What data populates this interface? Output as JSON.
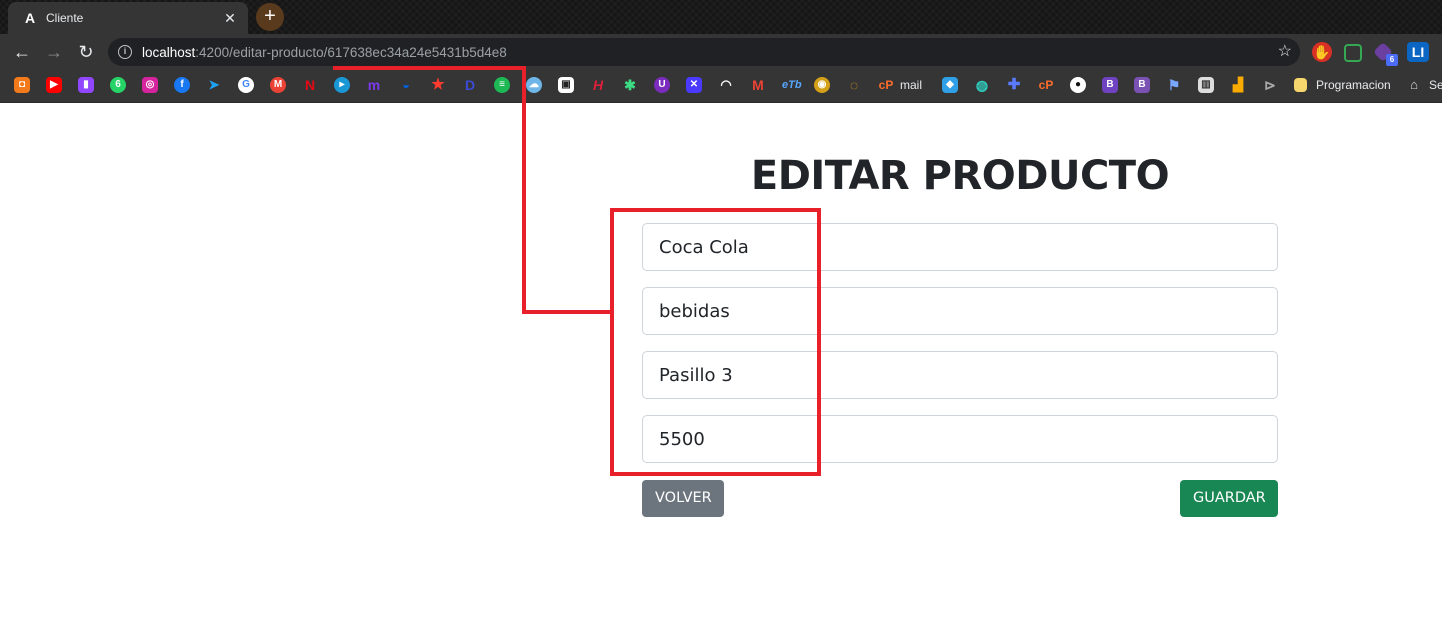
{
  "browser": {
    "tab": {
      "title": "Cliente",
      "favicon": "A",
      "close": "✕"
    },
    "new_tab": "+",
    "nav": {
      "back": "←",
      "forward": "→",
      "reload": "↻"
    },
    "address": {
      "info": "i",
      "host": "localhost",
      "path": ":4200/editar-producto/617638ec34a24e5431b5d4e8"
    },
    "bookmarks": {
      "mail_label": "mail",
      "programacion_label": "Programacion",
      "last_label": "Se"
    },
    "extensions": {
      "li_label": "LI",
      "badge": "6"
    }
  },
  "page": {
    "title": "EDITAR PRODUCTO",
    "fields": {
      "nombre": "Coca Cola",
      "categoria": "bebidas",
      "ubicacion": "Pasillo 3",
      "precio": "5500"
    },
    "buttons": {
      "back": "VOLVER",
      "save": "GUARDAR"
    }
  },
  "colors": {
    "annotation": "#e8202a",
    "secondary_button": "#6c757d",
    "success_button": "#198754"
  }
}
